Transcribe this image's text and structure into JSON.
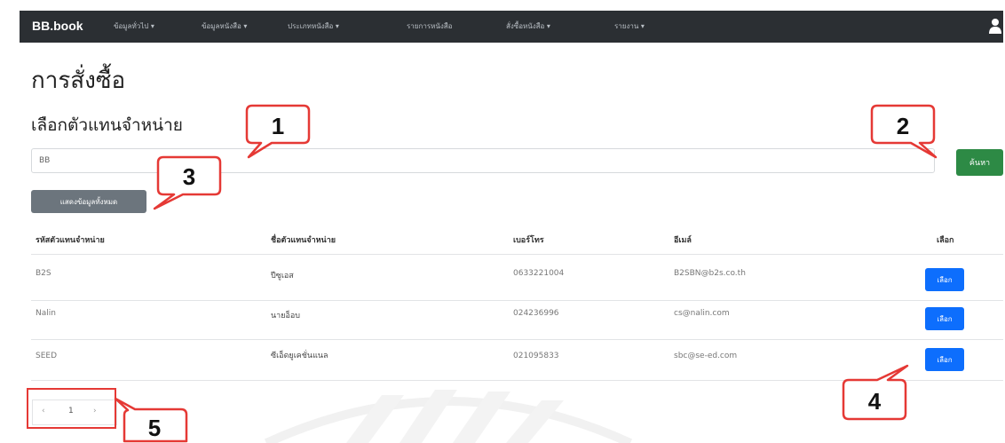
{
  "navbar": {
    "brand": "BB.book",
    "items": [
      "ข้อมูลทั่วไป ▾",
      "ข้อมูลหนังสือ ▾",
      "ประเภทหนังสือ ▾",
      "รายการหนังสือ",
      "สั่งซื้อหนังสือ ▾",
      "รายงาน ▾"
    ]
  },
  "page": {
    "title": "การสั่งซื้อ",
    "subtitle": "เลือกตัวแทนจำหน่าย"
  },
  "search": {
    "value": "BB",
    "button": "ค้นหา"
  },
  "show_all_button": "แสดงข้อมูลทั้งหมด",
  "table": {
    "headers": [
      "รหัสตัวแทนจำหน่าย",
      "ชื่อตัวแทนจำหน่าย",
      "เบอร์โทร",
      "อีเมล์",
      "เลือก"
    ],
    "rows": [
      {
        "code": "B2S",
        "name": "ปีซูเอส",
        "phone": "0633221004",
        "email": "B2SBN@b2s.co.th",
        "action": "เลือก"
      },
      {
        "code": "Nalin",
        "name": "นายอ็อบ",
        "phone": "024236996",
        "email": "cs@nalin.com",
        "action": "เลือก"
      },
      {
        "code": "SEED",
        "name": "ซีเอ็ดยูเคชั่นแนล",
        "phone": "021095833",
        "email": "sbc@se-ed.com",
        "action": "เลือก"
      }
    ]
  },
  "pagination": {
    "prev": "‹",
    "current": "1",
    "next": "›"
  },
  "callouts": [
    "1",
    "2",
    "3",
    "4",
    "5"
  ],
  "colors": {
    "navbar": "#2b2f33",
    "search_button": "#2d8a45",
    "show_all_button": "#6c757d",
    "select_button": "#0d6efd",
    "annotation": "#e53935"
  }
}
